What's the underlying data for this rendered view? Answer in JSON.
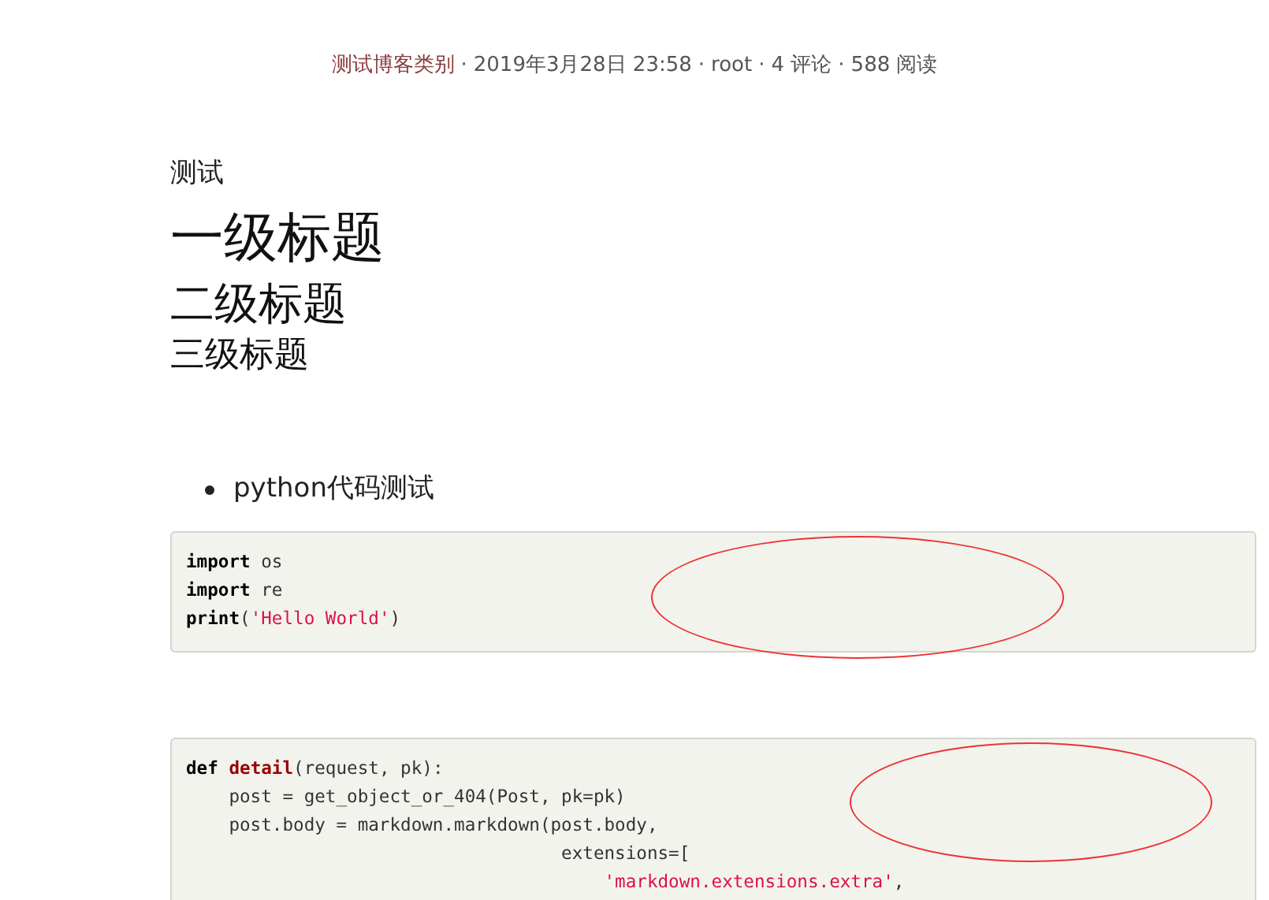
{
  "post_meta_separator": "·",
  "post_meta": [
    {
      "kind": "category",
      "text": "测试博客类别"
    },
    {
      "kind": "plain",
      "text": "2019年3月28日 23:58"
    },
    {
      "kind": "plain",
      "text": "root"
    },
    {
      "kind": "plain",
      "text": "4 评论"
    },
    {
      "kind": "plain",
      "text": "588 阅读"
    }
  ],
  "body": [
    {
      "kind": "p",
      "text": "测试"
    },
    {
      "kind": "h1",
      "text": "一级标题"
    },
    {
      "kind": "h2",
      "text": "二级标题"
    },
    {
      "kind": "h3",
      "text": "三级标题"
    },
    {
      "kind": "bullet",
      "text": "python代码测试"
    }
  ],
  "code_blocks": [
    {
      "circled": true,
      "lines": [
        [
          {
            "kind": "keyword",
            "text": "import"
          },
          {
            "kind": "plain",
            "text": " os"
          }
        ],
        [
          {
            "kind": "keyword",
            "text": "import"
          },
          {
            "kind": "plain",
            "text": " re"
          }
        ],
        [
          {
            "kind": "keyword",
            "text": "print"
          },
          {
            "kind": "plain",
            "text": "("
          },
          {
            "kind": "string",
            "text": "'Hello World'"
          },
          {
            "kind": "plain",
            "text": ")"
          }
        ]
      ]
    },
    {
      "circled": true,
      "lines": [
        [
          {
            "kind": "keyword",
            "text": "def "
          },
          {
            "kind": "function",
            "text": "detail"
          },
          {
            "kind": "plain",
            "text": "(request, pk):"
          }
        ],
        [
          {
            "kind": "plain",
            "text": "    post = get_object_or_404(Post, pk=pk)"
          }
        ],
        [
          {
            "kind": "plain",
            "text": "    post.body = markdown.markdown(post.body,"
          }
        ],
        [
          {
            "kind": "plain",
            "text": "                                   extensions=["
          }
        ],
        [
          {
            "kind": "string",
            "text": "                                       'markdown.extensions.extra'"
          },
          {
            "kind": "plain",
            "text": ","
          }
        ]
      ]
    }
  ]
}
